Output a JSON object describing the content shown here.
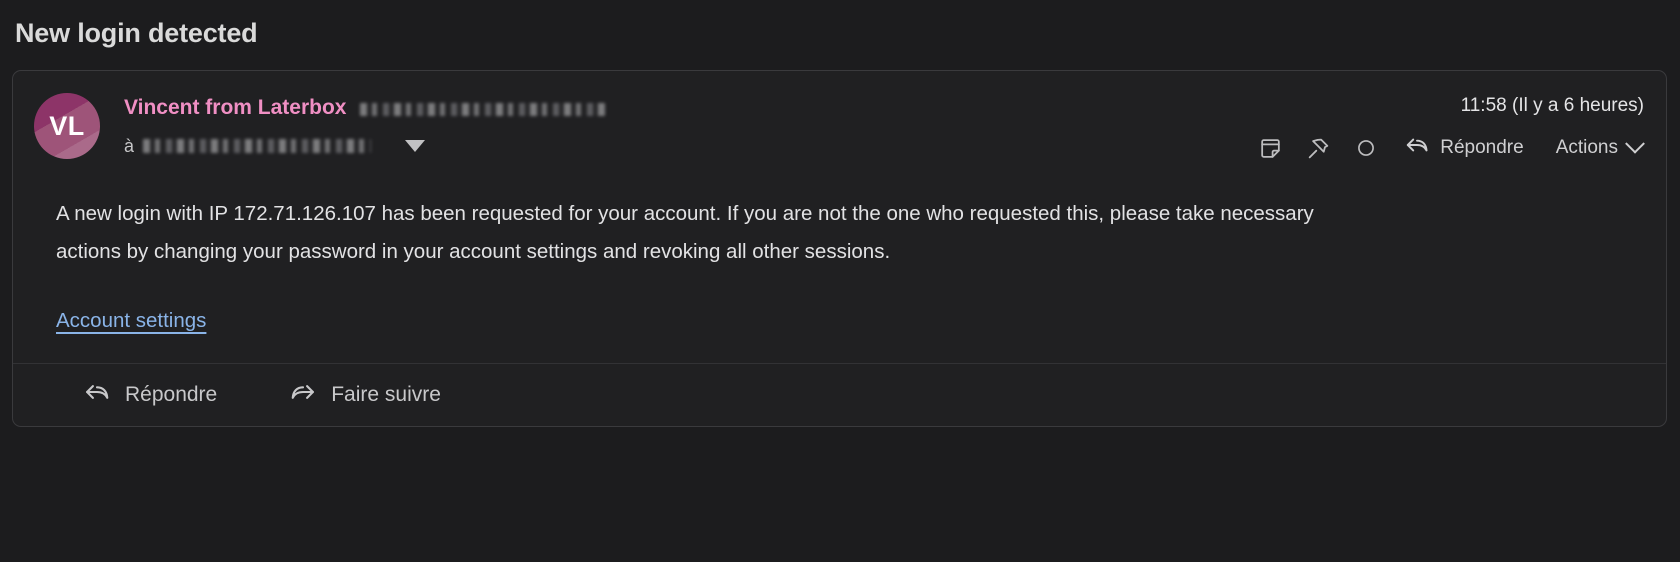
{
  "subject": "New login detected",
  "message": {
    "avatar": {
      "initials": "VL",
      "color": "#8d3468"
    },
    "sender": {
      "name": "Vincent from Laterbox",
      "email_redacted": true
    },
    "recipient": {
      "prefix": "à",
      "email_redacted": true,
      "expand_icon": "caret-down-icon"
    },
    "timestamp": "11:58 (Il y a 6 heures)",
    "header_actions": {
      "note_icon": "sticky-note-icon",
      "pin_icon": "pin-icon",
      "unread_icon": "circle-unread-icon",
      "reply_label": "Répondre",
      "reply_icon": "reply-arrow-icon",
      "actions_label": "Actions",
      "actions_chevron": "chevron-down-icon"
    },
    "body": {
      "paragraph": "A new login with IP 172.71.126.107 has been requested for your account. If you are not the one who requested this, please take necessary actions by changing your password in your account settings and revoking all other sessions.",
      "ip_address": "172.71.126.107",
      "link_label": "Account settings",
      "link_color": "#8ab4e8"
    },
    "footer": {
      "reply_label": "Répondre",
      "reply_icon": "reply-arrow-icon",
      "forward_label": "Faire suivre",
      "forward_icon": "forward-arrow-icon"
    }
  },
  "theme": {
    "background": "#1c1c1e",
    "card_background": "#202022",
    "card_border": "#3a3a3d",
    "text_primary": "#e2e2e4",
    "sender_accent": "#f08fc4"
  }
}
